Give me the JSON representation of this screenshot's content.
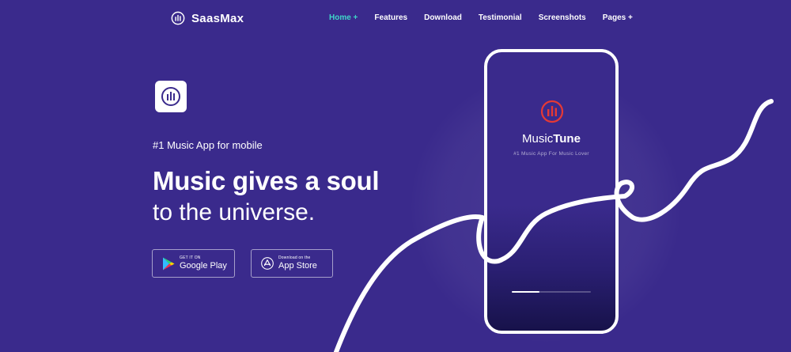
{
  "brand": {
    "name": "SaasMax",
    "icon": "equalizer-bars-icon"
  },
  "nav": {
    "items": [
      {
        "label": "Home +",
        "active": true
      },
      {
        "label": "Features",
        "active": false
      },
      {
        "label": "Download",
        "active": false
      },
      {
        "label": "Testimonial",
        "active": false
      },
      {
        "label": "Screenshots",
        "active": false
      },
      {
        "label": "Pages +",
        "active": false
      }
    ]
  },
  "hero": {
    "tagline": "#1 Music App for mobile",
    "headline_bold": "Music gives a soul",
    "headline_light": "to the universe.",
    "app_icon": "equalizer-bars-icon"
  },
  "buttons": {
    "google_play": {
      "small": "GET IT ON",
      "big": "Google Play",
      "icon": "google-play-icon"
    },
    "app_store": {
      "small": "Download on the",
      "big": "App Store",
      "icon": "app-store-icon"
    }
  },
  "phone": {
    "app_name_regular": "Music",
    "app_name_bold": "Tune",
    "subtitle": "#1 Music App For Music Lover",
    "logo_icon": "music-bars-circle-icon",
    "progress": 0.35
  },
  "colors": {
    "background": "#3a2a8c",
    "nav_active": "#3fd6c8",
    "logo_red": "#e53935",
    "white": "#ffffff"
  }
}
